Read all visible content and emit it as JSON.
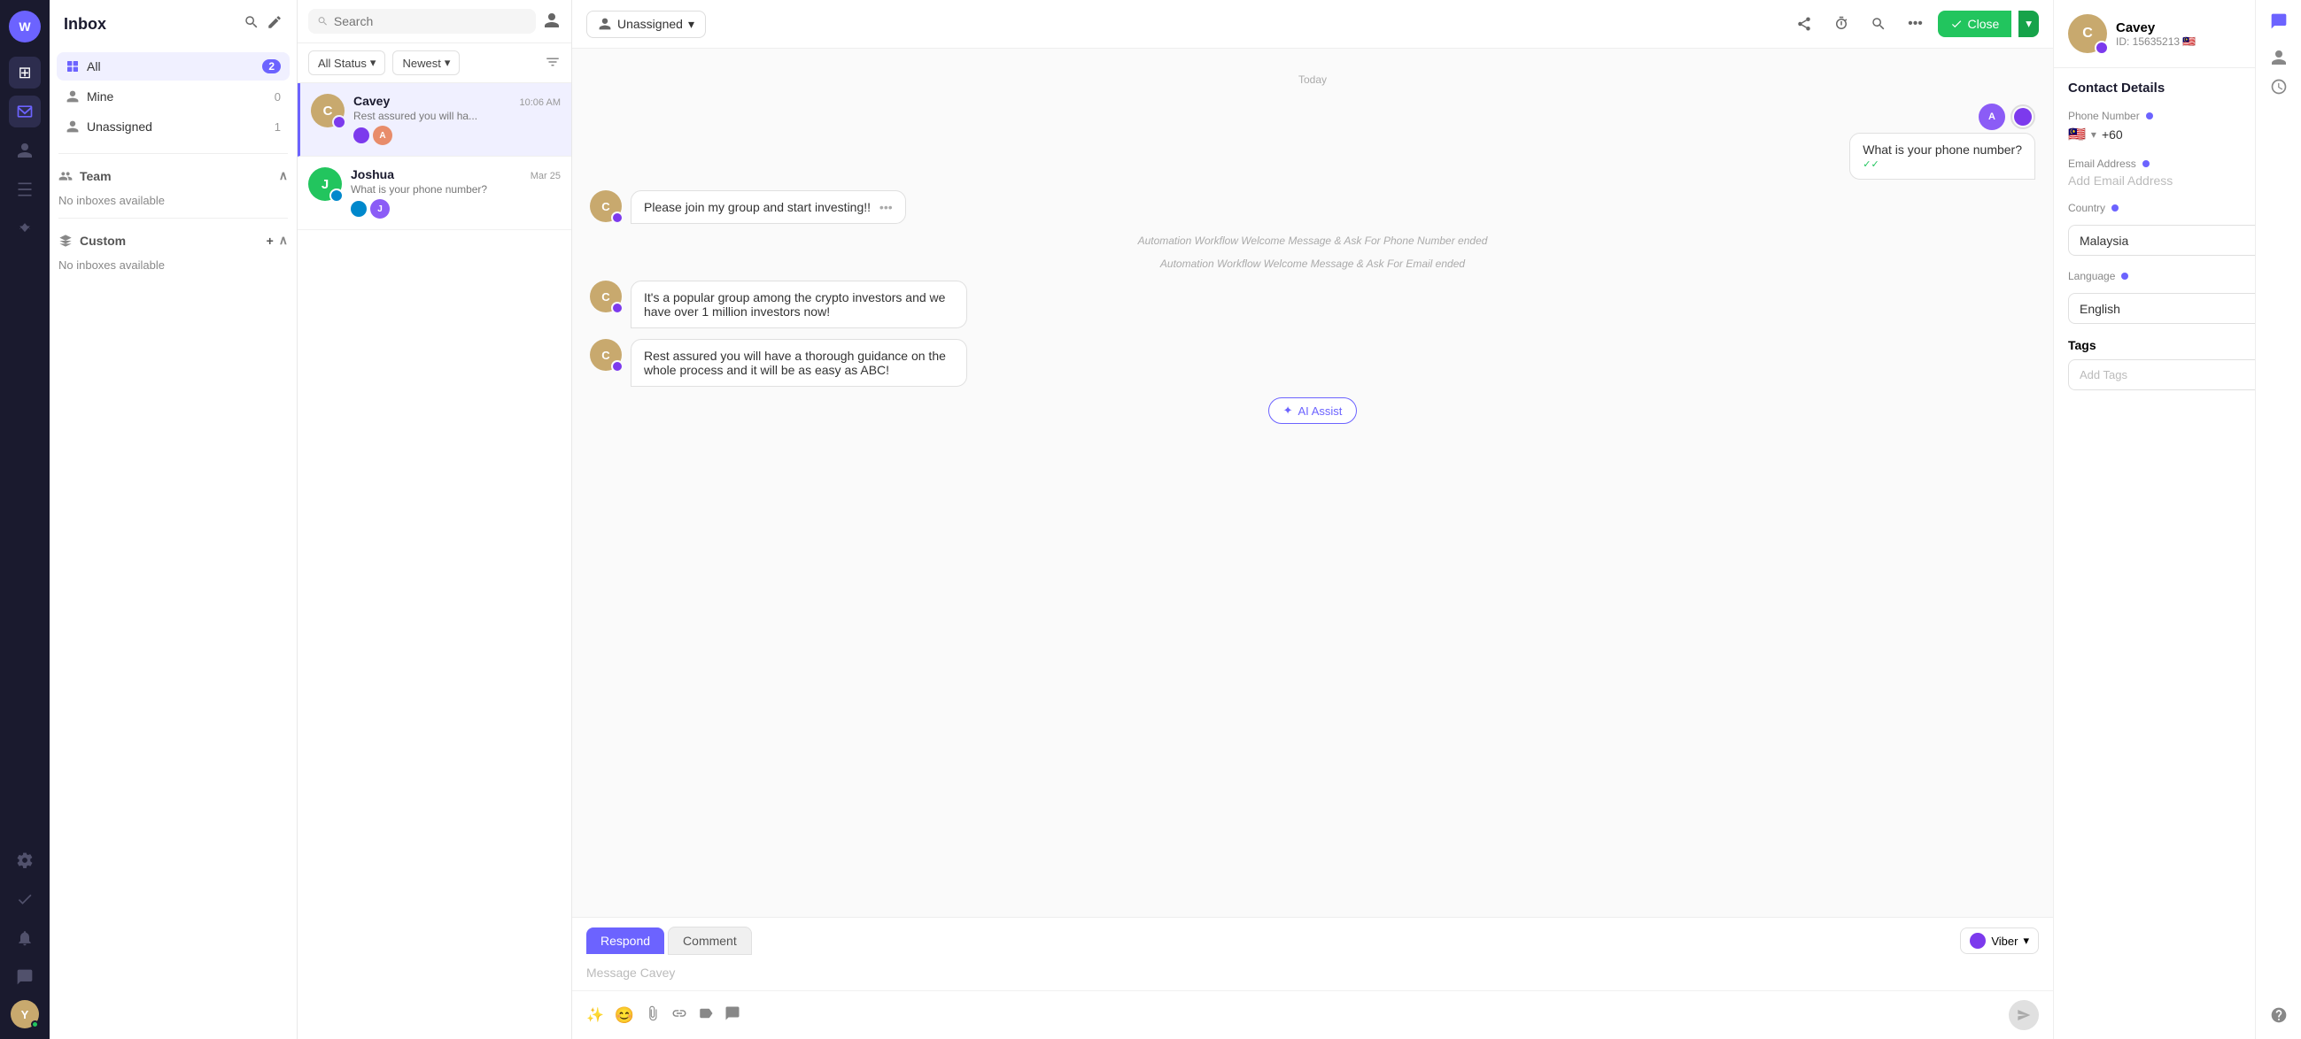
{
  "app": {
    "title": "Inbox"
  },
  "left_nav": {
    "user_initial": "Y",
    "icons": [
      "⊞",
      "📥",
      "👤",
      "📊",
      "⚙",
      "✓",
      "🔔",
      "💬"
    ]
  },
  "sidebar": {
    "header": "Inbox",
    "all_label": "All",
    "all_count": "2",
    "mine_label": "Mine",
    "mine_count": "0",
    "unassigned_label": "Unassigned",
    "unassigned_count": "1",
    "team_label": "Team",
    "team_no_inbox": "No inboxes available",
    "custom_label": "Custom",
    "custom_no_inbox": "No inboxes available"
  },
  "conv_list": {
    "search_placeholder": "Search",
    "filter_status": "All Status",
    "filter_sort": "Newest",
    "conversations": [
      {
        "name": "Cavey",
        "preview": "Rest assured you will ha...",
        "time": "10:06 AM",
        "avatar_color": "#c8a96e",
        "avatar_initial": "C",
        "channel": "viber",
        "active": true
      },
      {
        "name": "Joshua",
        "preview": "What is your phone number?",
        "time": "Mar 25",
        "avatar_color": "#22c55e",
        "avatar_initial": "J",
        "channel": "telegram",
        "active": false
      }
    ]
  },
  "chat": {
    "assign_label": "Unassigned",
    "date_label": "Today",
    "close_btn": "Close",
    "messages": [
      {
        "type": "right",
        "text": "What is your phone number?",
        "tick": "✓✓"
      },
      {
        "type": "left",
        "text": "Please join my group and start investing!!"
      },
      {
        "type": "automation",
        "text": "Automation Workflow Welcome Message & Ask For Phone Number ended"
      },
      {
        "type": "automation",
        "text": "Automation Workflow Welcome Message & Ask For Email ended"
      },
      {
        "type": "left",
        "text": "It's a popular group among the crypto investors and we have over 1 million investors now!"
      },
      {
        "type": "left",
        "text": "Rest assured you will have a thorough guidance on the whole process and it will be as easy as ABC!"
      }
    ],
    "ai_assist_label": "AI Assist",
    "respond_tab": "Respond",
    "comment_tab": "Comment",
    "channel_label": "Viber",
    "message_placeholder": "Message Cavey",
    "toolbar_icons": [
      "✨",
      "😊",
      "📎",
      "🔗",
      "🏷",
      "💬"
    ]
  },
  "contact": {
    "name": "Cavey",
    "id": "ID: 15635213",
    "flag": "🇲🇾",
    "section_title": "Contact Details",
    "phone_label": "Phone Number",
    "phone_flag": "🇲🇾",
    "phone_code": "+60",
    "email_label": "Email Address",
    "email_placeholder": "Add Email Address",
    "country_label": "Country",
    "country_value": "Malaysia",
    "language_label": "Language",
    "language_value": "English",
    "tags_label": "Tags",
    "tags_placeholder": "Add Tags"
  }
}
